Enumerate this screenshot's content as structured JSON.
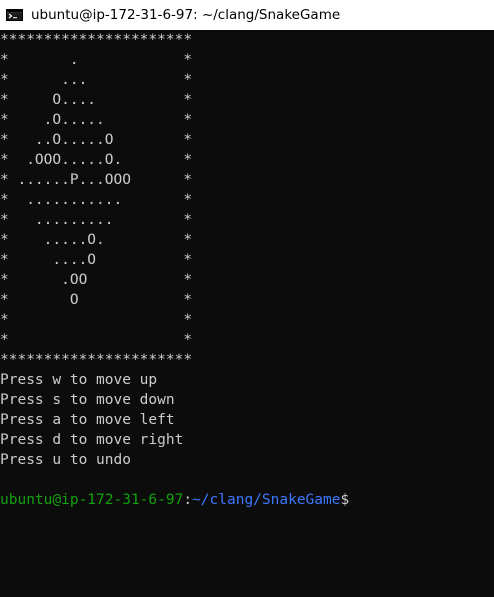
{
  "window": {
    "title": "ubuntu@ip-172-31-6-97: ~/clang/SnakeGame",
    "icon": "terminal-icon"
  },
  "board": {
    "rows": [
      "**********************",
      "*       .            *",
      "*      ...           *",
      "*     O....          *",
      "*    .O.....         *",
      "*   ..O.....O        *",
      "*  .OOO.....O.       *",
      "* ......P...OOO      *",
      "*  ...........       *",
      "*   .........        *",
      "*    .....O.         *",
      "*     ....O          *",
      "*      .OO           *",
      "*       O            *",
      "*                    *",
      "*                    *",
      "**********************"
    ]
  },
  "instructions": [
    "Press w to move up",
    "Press s to move down",
    "Press a to move left",
    "Press d to move right",
    "Press u to undo"
  ],
  "prompt": {
    "user_host": "ubuntu@ip-172-31-6-97",
    "separator": ":",
    "path": "~/clang/SnakeGame",
    "symbol": "$"
  },
  "colors": {
    "background": "#0c0c0c",
    "text": "#cccccc",
    "prompt_user": "#13a10e",
    "prompt_path": "#3b78ff",
    "titlebar": "#ffffff"
  }
}
